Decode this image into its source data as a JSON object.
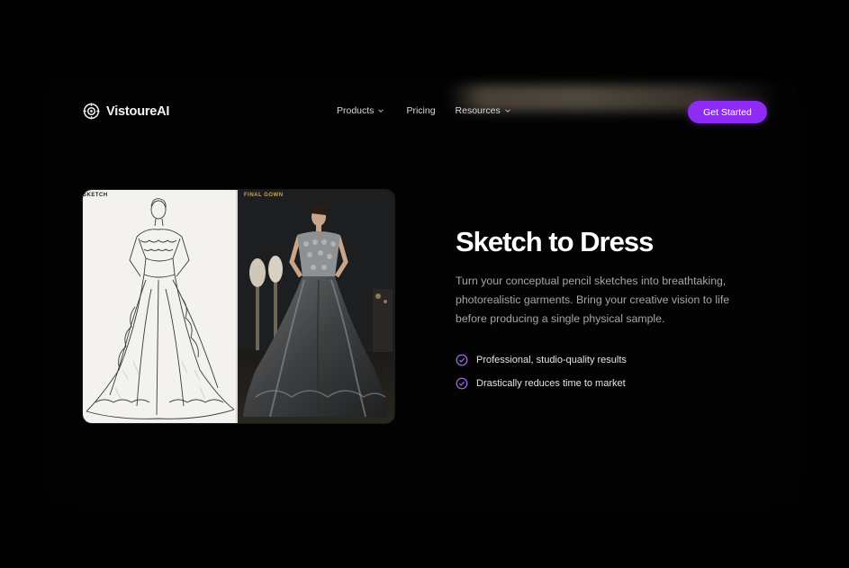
{
  "brand": {
    "name": "VistoureAI",
    "icon": "target-logo-icon"
  },
  "nav": {
    "links": [
      {
        "label": "Products",
        "has_dropdown": true
      },
      {
        "label": "Pricing",
        "has_dropdown": false
      },
      {
        "label": "Resources",
        "has_dropdown": true
      }
    ],
    "cta_label": "Get Started"
  },
  "showcase": {
    "left_label": "SKETCH",
    "right_label": "FINAL GOWN"
  },
  "hero": {
    "title": "Sketch to Dress",
    "description": "Turn your conceptual pencil sketches into breathtaking, photorealistic garments. Bring your creative vision to life before producing a single physical sample.",
    "features": [
      "Professional, studio-quality results",
      "Drastically reduces time to market"
    ]
  },
  "colors": {
    "background": "#000000",
    "accent": "#8e2cf5",
    "check": "#a66bf0",
    "label_gold": "#c9a74f",
    "body_text": "#a6a6a8"
  }
}
